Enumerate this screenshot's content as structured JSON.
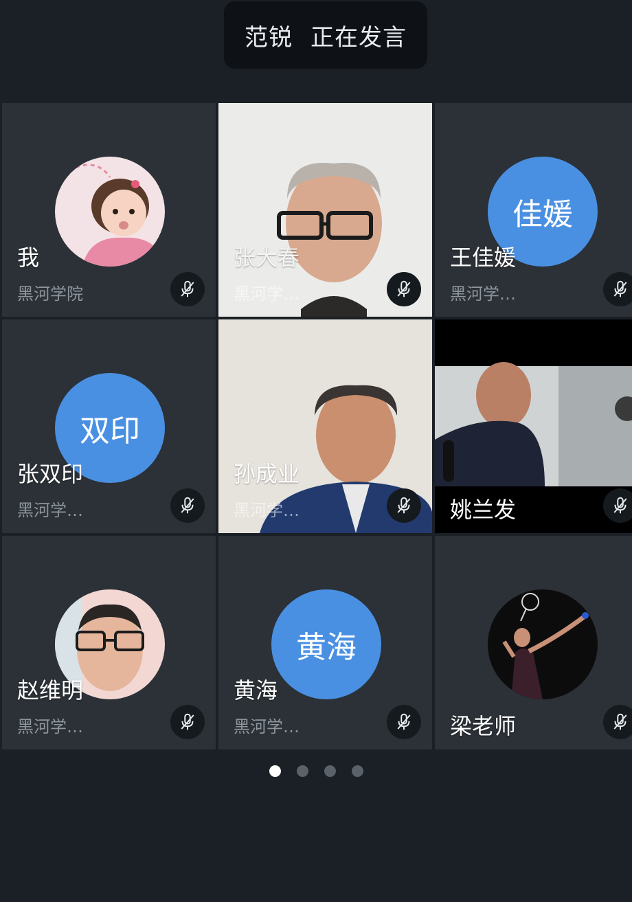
{
  "speaker_banner": {
    "name": "范锐",
    "status": "正在发言"
  },
  "participants": [
    {
      "name": "我",
      "org": "黑河学院",
      "avatar": "photo-child",
      "muted": true
    },
    {
      "name": "张大春",
      "org": "黑河学…",
      "avatar": "video",
      "muted": true
    },
    {
      "name": "王佳媛",
      "org": "黑河学…",
      "initials": "佳媛",
      "muted": true
    },
    {
      "name": "张双印",
      "org": "黑河学…",
      "initials": "双印",
      "muted": true
    },
    {
      "name": "孙成业",
      "org": "黑河学…",
      "avatar": "video",
      "muted": true
    },
    {
      "name": "姚兰发",
      "org": "",
      "avatar": "video",
      "muted": true
    },
    {
      "name": "赵维明",
      "org": "黑河学…",
      "avatar": "photo-man-glasses",
      "muted": true
    },
    {
      "name": "黄海",
      "org": "黑河学…",
      "initials": "黄海",
      "muted": true
    },
    {
      "name": "梁老师",
      "org": "",
      "avatar": "photo-badminton",
      "muted": true
    }
  ],
  "pagination": {
    "pages": 4,
    "current": 1
  },
  "colors": {
    "initials_avatar": "#4a90e2",
    "tile_bg": "#2b3137",
    "page_bg": "#1b2026"
  },
  "icons": {
    "muted": "mic-off-icon"
  }
}
